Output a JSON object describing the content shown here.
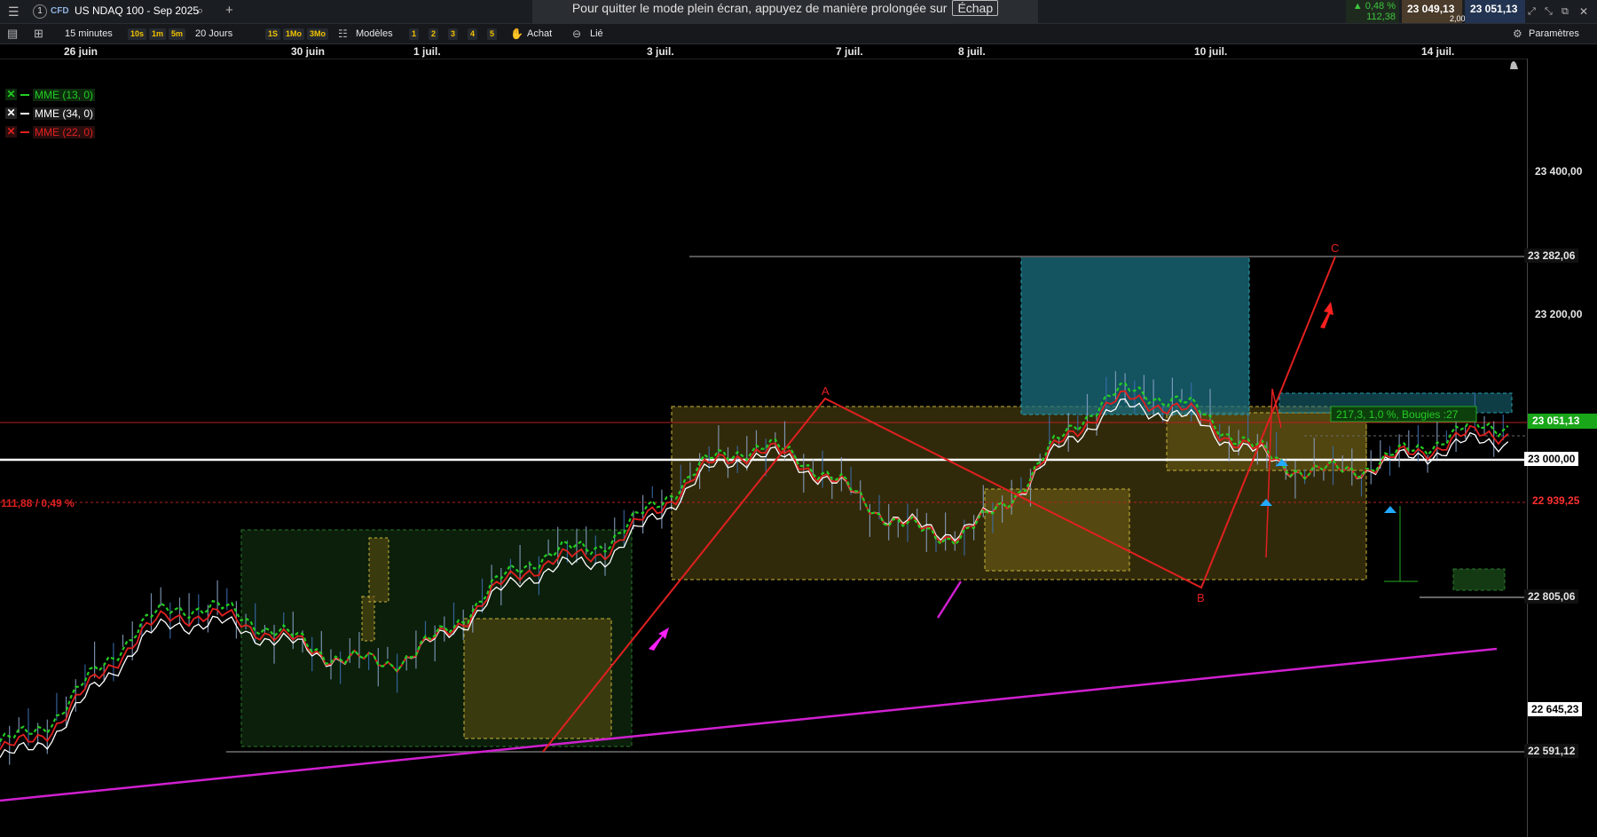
{
  "topbar": {
    "tab_number": "1",
    "cfd_badge": "CFD",
    "instrument_title": "US NDAQ 100 - Sep 2025",
    "add_tab": "+",
    "fullscreen_notice": "Pour quitter le mode plein écran, appuyez de manière prolongée sur",
    "escape_key": "Échap",
    "change_percent": "▲ 0,48 %",
    "change_points": "112,38",
    "bid": "23 049,13",
    "spread": "2,00",
    "ask": "23 051,13"
  },
  "toolbar": {
    "interval": "15 minutes",
    "quick_intervals": [
      "10s",
      "1m",
      "5m"
    ],
    "range": "20 Jours",
    "quick_ranges": [
      "1S",
      "1Mo",
      "3Mo"
    ],
    "templates": "Modèles",
    "layouts": [
      "1",
      "2",
      "3",
      "4",
      "5"
    ],
    "buy": "Achat",
    "linked": "Lié",
    "settings": "Paramètres"
  },
  "time_axis": [
    "26 juin",
    "30 juin",
    "1 juil.",
    "3 juil.",
    "7 juil.",
    "8 juil.",
    "10 juil.",
    "14 juil."
  ],
  "legend": [
    {
      "label": "MME (13, 0)",
      "color": "#22cc22"
    },
    {
      "label": "MME (34, 0)",
      "color": "#ffffff"
    },
    {
      "label": "MME (22, 0)",
      "color": "#e02020"
    }
  ],
  "annotations": {
    "wave_a": "A",
    "wave_b": "B",
    "wave_c": "C",
    "range_label": "217,3, 1,0 %, Bougies :27",
    "change_label": "111,88 / 0,49 %"
  },
  "price_axis": {
    "labels": [
      "23 400,00",
      "23 282,06",
      "23 200,00",
      "23 000,00",
      "22 805,06",
      "22 645,23",
      "22 591,12"
    ],
    "current_price": "23 051,13",
    "ref_price": "22 939,25"
  },
  "chart_data": {
    "type": "line",
    "instrument": "US NDAQ 100 - Sep 2025",
    "interval": "15 minutes",
    "x": [
      "26 juin",
      "30 juin",
      "1 juil.",
      "3 juil.",
      "7 juil.",
      "8 juil.",
      "10 juil.",
      "14 juil."
    ],
    "series": [
      {
        "name": "MME (13, 0)",
        "values": [
          22620,
          22790,
          22720,
          22860,
          22990,
          22880,
          23060,
          22960,
          23020
        ]
      },
      {
        "name": "MME (34, 0)",
        "values": [
          22600,
          22770,
          22720,
          22840,
          22980,
          22885,
          23040,
          22960,
          23000
        ]
      },
      {
        "name": "MME (22, 0)",
        "values": [
          22610,
          22780,
          22720,
          22850,
          22985,
          22882,
          23050,
          22960,
          23010
        ]
      }
    ],
    "ylim": [
      22500,
      23480
    ],
    "y_ticks": [
      23400,
      23282.06,
      23200,
      23000,
      22805.06,
      22645.23,
      22591.12
    ],
    "current_price": 23051.13,
    "horizontal_levels": [
      23282.06,
      23051.13,
      23000,
      22939.25,
      22805.06,
      22591.12
    ],
    "grid": false,
    "colors": {
      "ema13": "#22cc22",
      "ema34": "#ffffff",
      "ema22": "#e02020",
      "trend": "#d020d0",
      "wave": "#e02020",
      "box_yellow": "#c8b43c",
      "box_green": "#1e6e1e",
      "box_teal": "#2aa0b0"
    }
  }
}
